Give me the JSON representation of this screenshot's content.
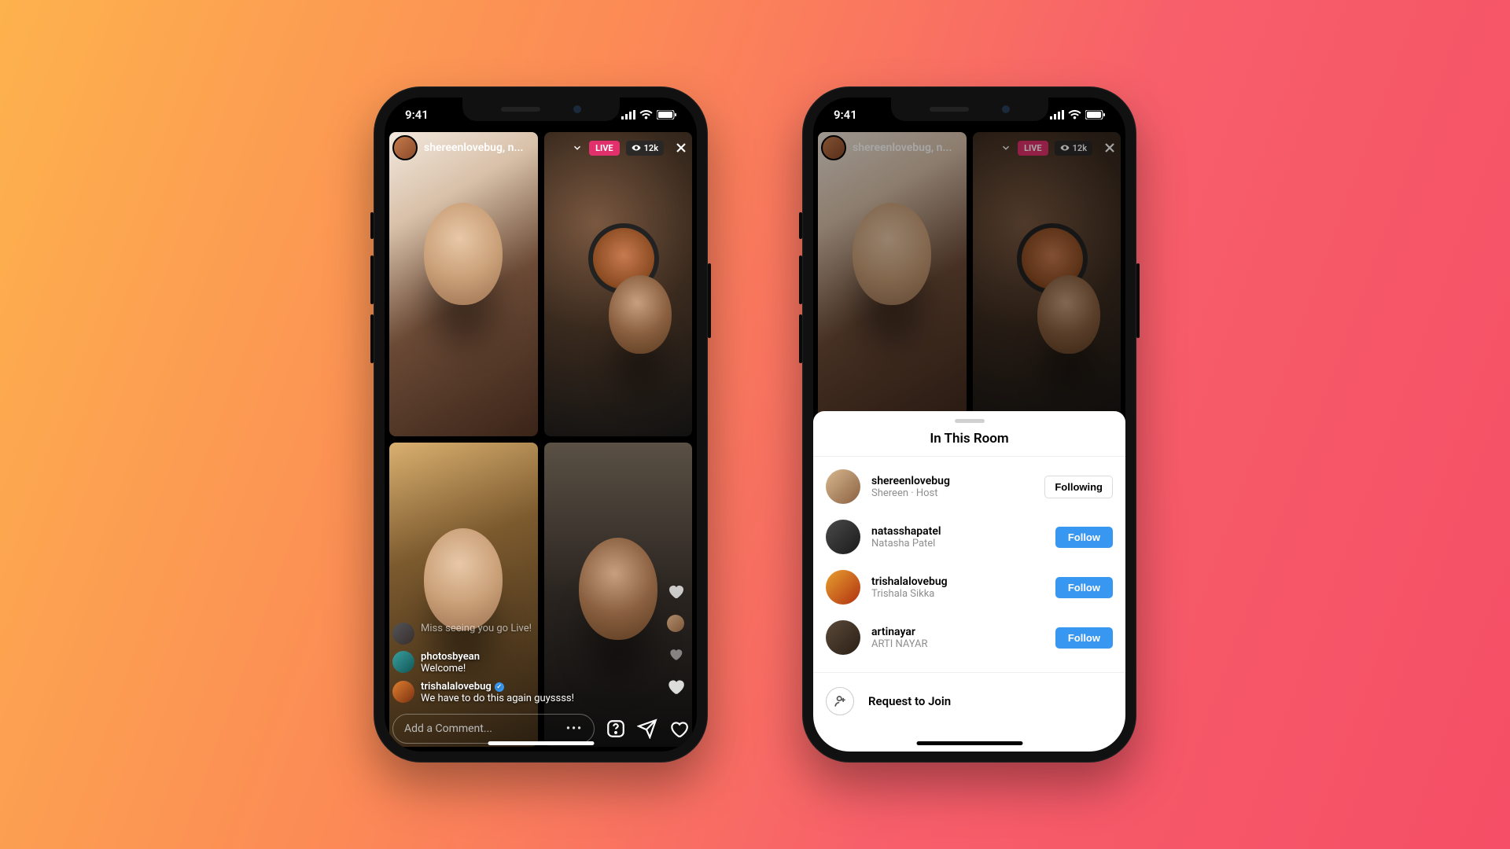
{
  "status": {
    "time": "9:41"
  },
  "live": {
    "host_label": "shereenlovebug, n...",
    "live_badge": "LIVE",
    "viewer_count": "12k"
  },
  "comments": [
    {
      "user": "",
      "text": "Miss seeing you go Live!"
    },
    {
      "user": "photosbyean",
      "text": "Welcome!"
    },
    {
      "user": "trishalalovebug",
      "text": "We have to do this again guyssss!",
      "verified": true
    }
  ],
  "comment_input": {
    "placeholder": "Add a Comment..."
  },
  "sheet": {
    "title": "In This Room",
    "items": [
      {
        "username": "shereenlovebug",
        "subtitle": "Shereen · Host",
        "action": "Following"
      },
      {
        "username": "natasshapatel",
        "subtitle": "Natasha Patel",
        "action": "Follow"
      },
      {
        "username": "trishalalovebug",
        "subtitle": "Trishala Sikka",
        "action": "Follow"
      },
      {
        "username": "artinayar",
        "subtitle": "ARTI NAYAR",
        "action": "Follow"
      }
    ],
    "request_label": "Request to Join"
  },
  "colors": {
    "live_pink": "#e1306c",
    "follow_blue": "#3897f0"
  }
}
